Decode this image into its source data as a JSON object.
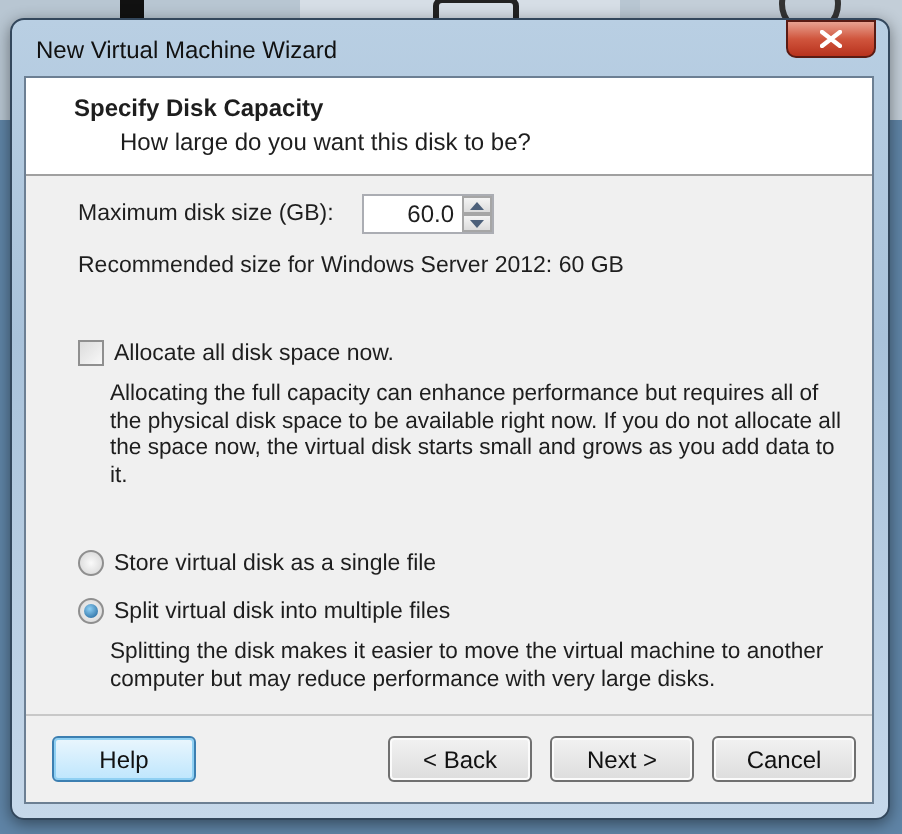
{
  "window": {
    "title": "New Virtual Machine Wizard"
  },
  "header": {
    "title": "Specify Disk Capacity",
    "subtitle": "How large do you want this disk to be?"
  },
  "disk_size": {
    "label": "Maximum disk size (GB):",
    "value": "60.0"
  },
  "recommendation": "Recommended size for Windows Server 2012: 60 GB",
  "allocate": {
    "label": "Allocate all disk space now.",
    "checked": false,
    "description": "Allocating the full capacity can enhance performance but requires all of the physical disk space to be available right now. If you do not allocate all the space now, the virtual disk starts small and grows as you add data to it."
  },
  "storage_options": [
    {
      "label": "Store virtual disk as a single file",
      "selected": false
    },
    {
      "label": "Split virtual disk into multiple files",
      "selected": true,
      "description": "Splitting the disk makes it easier to move the virtual machine to another computer but may reduce performance with very large disks."
    }
  ],
  "buttons": [
    {
      "label": "Help",
      "focused": true
    },
    {
      "label": "< Back",
      "focused": false
    },
    {
      "label": "Next >",
      "focused": false
    },
    {
      "label": "Cancel",
      "focused": false
    }
  ]
}
